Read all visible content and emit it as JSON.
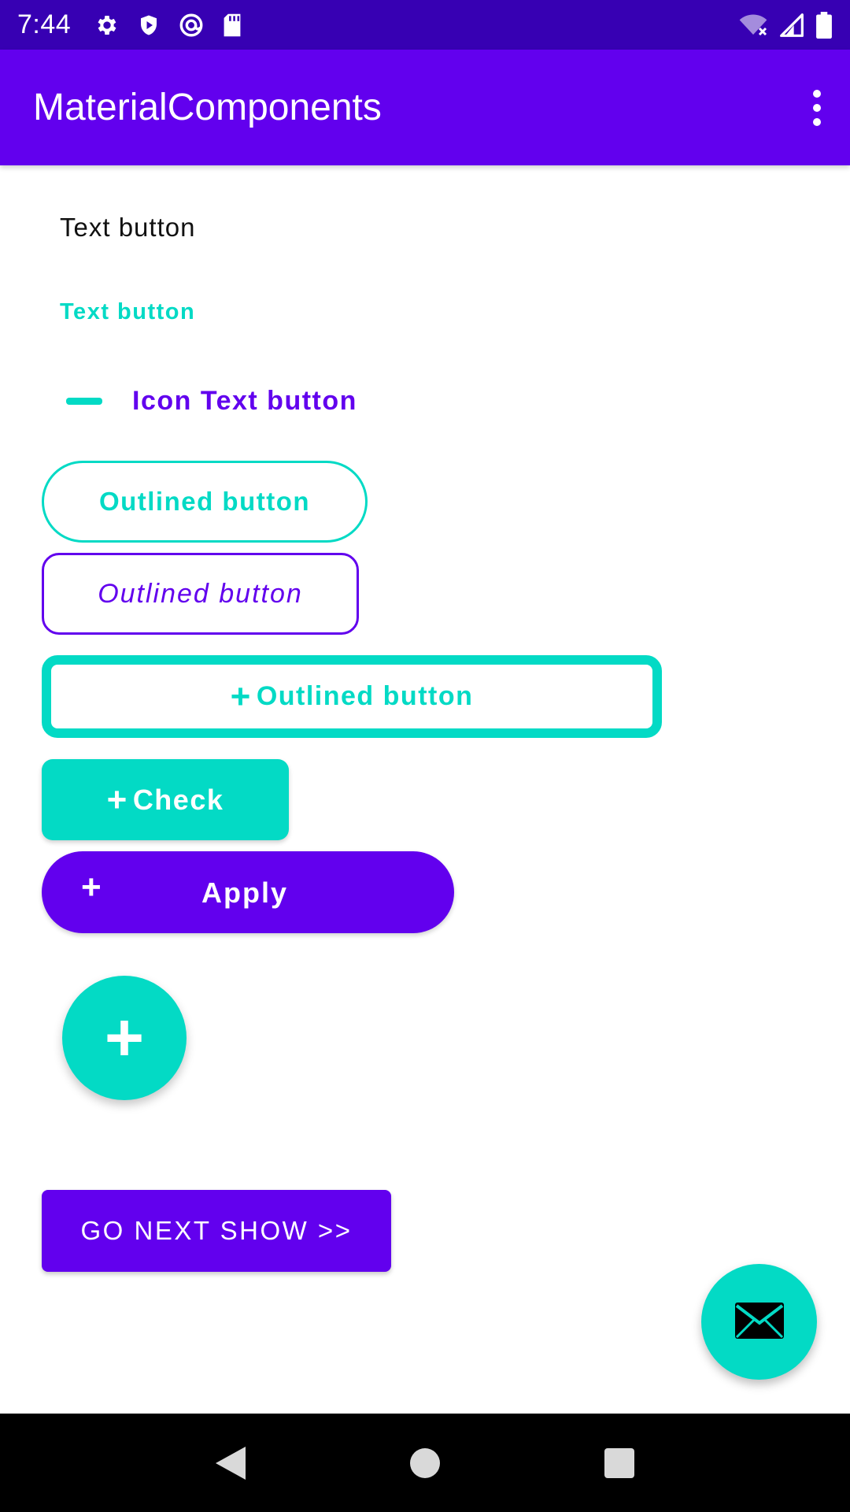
{
  "status_bar": {
    "time": "7:44",
    "icons_left": [
      "gear-icon",
      "shield-play-icon",
      "at-sign-icon",
      "sd-card-icon"
    ],
    "icons_right": [
      "wifi-off-icon",
      "signal-icon",
      "battery-icon"
    ]
  },
  "app_bar": {
    "title": "MaterialComponents",
    "overflow_icon": "more-vert-icon"
  },
  "buttons": {
    "text_button_1": "Text button",
    "text_button_2": "Text button",
    "icon_text_button": "Icon Text button",
    "outlined_1": "Outlined button",
    "outlined_2": "Outlined button",
    "outlined_3": "Outlined button",
    "check": "Check",
    "apply": "Apply",
    "next": "GO NEXT SHOW >>"
  },
  "fabs": {
    "plus_icon": "plus-icon",
    "mail_icon": "mail-icon"
  },
  "colors": {
    "primary": "#6200ee",
    "primary_dark": "#3700b3",
    "secondary": "#03dac5",
    "on_primary": "#ffffff"
  }
}
